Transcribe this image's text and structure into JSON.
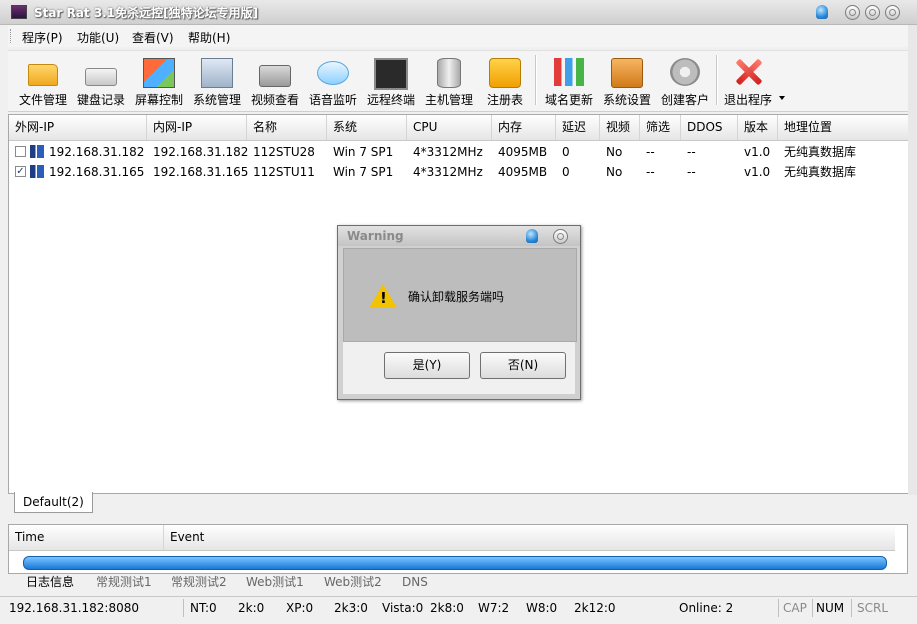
{
  "window": {
    "title": "Star Rat 3.1免杀远控[独特论坛专用版]"
  },
  "menu": [
    "程序(P)",
    "功能(U)",
    "查看(V)",
    "帮助(H)"
  ],
  "toolbar": [
    {
      "label": "文件管理",
      "icon": "folder-icon"
    },
    {
      "label": "键盘记录",
      "icon": "keyboard-icon"
    },
    {
      "label": "屏幕控制",
      "icon": "screen-icon"
    },
    {
      "label": "系统管理",
      "icon": "system-icon"
    },
    {
      "label": "视频查看",
      "icon": "camera-icon"
    },
    {
      "label": "语音监听",
      "icon": "speech-icon"
    },
    {
      "label": "远程终端",
      "icon": "terminal-icon"
    },
    {
      "label": "主机管理",
      "icon": "database-icon"
    },
    {
      "label": "注册表",
      "icon": "puzzle-icon"
    },
    {
      "label": "域名更新",
      "icon": "bar-chart-icon"
    },
    {
      "label": "系统设置",
      "icon": "box-icon"
    },
    {
      "label": "创建客户",
      "icon": "gear-icon"
    },
    {
      "label": "退出程序",
      "icon": "close-icon"
    }
  ],
  "table": {
    "columns": [
      "外网-IP",
      "内网-IP",
      "名称",
      "系统",
      "CPU",
      "内存",
      "延迟",
      "视频",
      "筛选",
      "DDOS",
      "版本",
      "地理位置"
    ],
    "rows": [
      {
        "checked": false,
        "cells": [
          "192.168.31.182",
          "192.168.31.182",
          "112STU28",
          "Win 7 SP1",
          "4*3312MHz",
          "4095MB",
          "0",
          "No",
          "--",
          "--",
          "v1.0",
          "无纯真数据库"
        ]
      },
      {
        "checked": true,
        "cells": [
          "192.168.31.165",
          "192.168.31.165",
          "112STU11",
          "Win 7 SP1",
          "4*3312MHz",
          "4095MB",
          "0",
          "No",
          "--",
          "--",
          "v1.0",
          "无纯真数据库"
        ]
      }
    ]
  },
  "group_tab": "Default(2)",
  "log": {
    "columns": [
      "Time",
      "Event"
    ]
  },
  "log_tabs": [
    "日志信息",
    "常规测试1",
    "常规测试2",
    "Web测试1",
    "Web测试2",
    "DNS"
  ],
  "status": {
    "address": "192.168.31.182:8080",
    "counts": [
      "NT:0",
      "2k:0",
      "XP:0",
      "2k3:0",
      "Vista:0",
      "2k8:0",
      "W7:2",
      "W8:0",
      "2k12:0"
    ],
    "online": "Online: 2",
    "caps": "CAP",
    "num": "NUM",
    "scrl": "SCRL"
  },
  "dialog": {
    "title": "Warning",
    "message": "确认卸载服务端吗",
    "yes": "是(Y)",
    "no": "否(N)"
  }
}
